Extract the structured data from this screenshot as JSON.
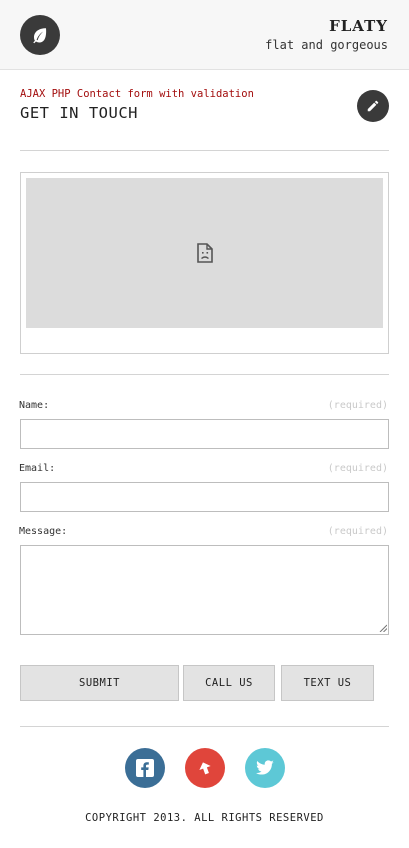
{
  "header": {
    "brand_name": "FLATY",
    "tagline": "flat and gorgeous",
    "logo_icon": "leaf-icon"
  },
  "intro": {
    "subtitle": "AJAX PHP Contact form with validation",
    "title": "GET IN TOUCH",
    "edit_icon": "pencil-icon"
  },
  "map": {
    "icon": "broken-image-icon"
  },
  "form": {
    "name_label": "Name:",
    "email_label": "Email:",
    "message_label": "Message:",
    "required_hint": "(required)",
    "name_value": "",
    "email_value": "",
    "message_value": ""
  },
  "buttons": {
    "submit": "SUBMIT",
    "call": "CALL US",
    "text": "TEXT US"
  },
  "social": {
    "facebook_color": "#3b6e96",
    "up_color": "#e0453b",
    "twitter_color": "#5dc8d6"
  },
  "footer": {
    "copyright": "COPYRIGHT 2013. ALL RIGHTS RESERVED"
  },
  "colors": {
    "accent_red": "#a30d0d",
    "dark_circle": "#3a3a3a"
  }
}
